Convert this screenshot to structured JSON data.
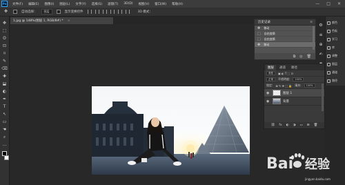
{
  "menubar": {
    "logo": "Ps",
    "items": [
      "文件(F)",
      "编辑(E)",
      "图像(I)",
      "图层(L)",
      "文字(Y)",
      "选择(S)",
      "滤镜(T)",
      "3D(D)",
      "视图(V)",
      "窗口(W)",
      "帮助(H)"
    ],
    "controls": [
      "—",
      "□",
      "✕"
    ]
  },
  "options": {
    "auto_select_label": "自动选择：",
    "auto_select_value": "图层",
    "show_transform_label": "显示变换控件",
    "mode_3d_label": "3D 模式："
  },
  "document": {
    "tab_title": "1.jpg @ 148%(图层 1, RGB/8#) *",
    "tab_close": "×"
  },
  "tools": [
    "✥",
    "⬚",
    "ʘ",
    "⊡",
    "⌑",
    "✎",
    "⌫",
    "✚",
    "⬓",
    "◐",
    "✒",
    "T",
    "↖",
    "▭",
    "☚",
    "⌕",
    "…"
  ],
  "history": {
    "title": "历史记录",
    "menu_icon": "≡",
    "items": [
      {
        "label": "移动",
        "active": false
      },
      {
        "label": "自由变换",
        "active": false
      },
      {
        "label": "自由变换",
        "active": false
      },
      {
        "label": "移动",
        "active": true
      }
    ],
    "footer_icons": [
      "⧉",
      "◎",
      "🗑"
    ]
  },
  "right_icons": [
    "⚙",
    "≡",
    "⊕",
    "✍",
    "◉",
    "⌘",
    "A"
  ],
  "side_panel": {
    "items": [
      "颜色",
      "色板",
      "学习",
      "库",
      "调整",
      "图层",
      "通道",
      "路径"
    ]
  },
  "layers": {
    "tabs": [
      {
        "label": "图层",
        "active": true
      },
      {
        "label": "通道",
        "active": false
      },
      {
        "label": "路径",
        "active": false
      }
    ],
    "kind_filter": "类型",
    "blend_mode": "正常",
    "opacity_label": "不透明度:",
    "opacity_value": "100%",
    "lock_label": "锁定:",
    "fill_label": "填充:",
    "fill_value": "100%",
    "items": [
      {
        "name": "图层 1",
        "selected": true,
        "thumb": "person"
      },
      {
        "name": "背景",
        "selected": false,
        "thumb": "bg"
      }
    ],
    "footer_icons": [
      "⛓",
      "fx",
      "◐",
      "◑",
      "▭",
      "⊞",
      "🗑"
    ]
  },
  "watermark": {
    "brand": "Bai",
    "brand_cn": "经验",
    "site": "jingyan.baidu.com"
  },
  "colors": {
    "menubar": "#3c3c3c",
    "panel": "#323232",
    "canvas_bg": "#282828",
    "accent": "#31a8ff"
  }
}
